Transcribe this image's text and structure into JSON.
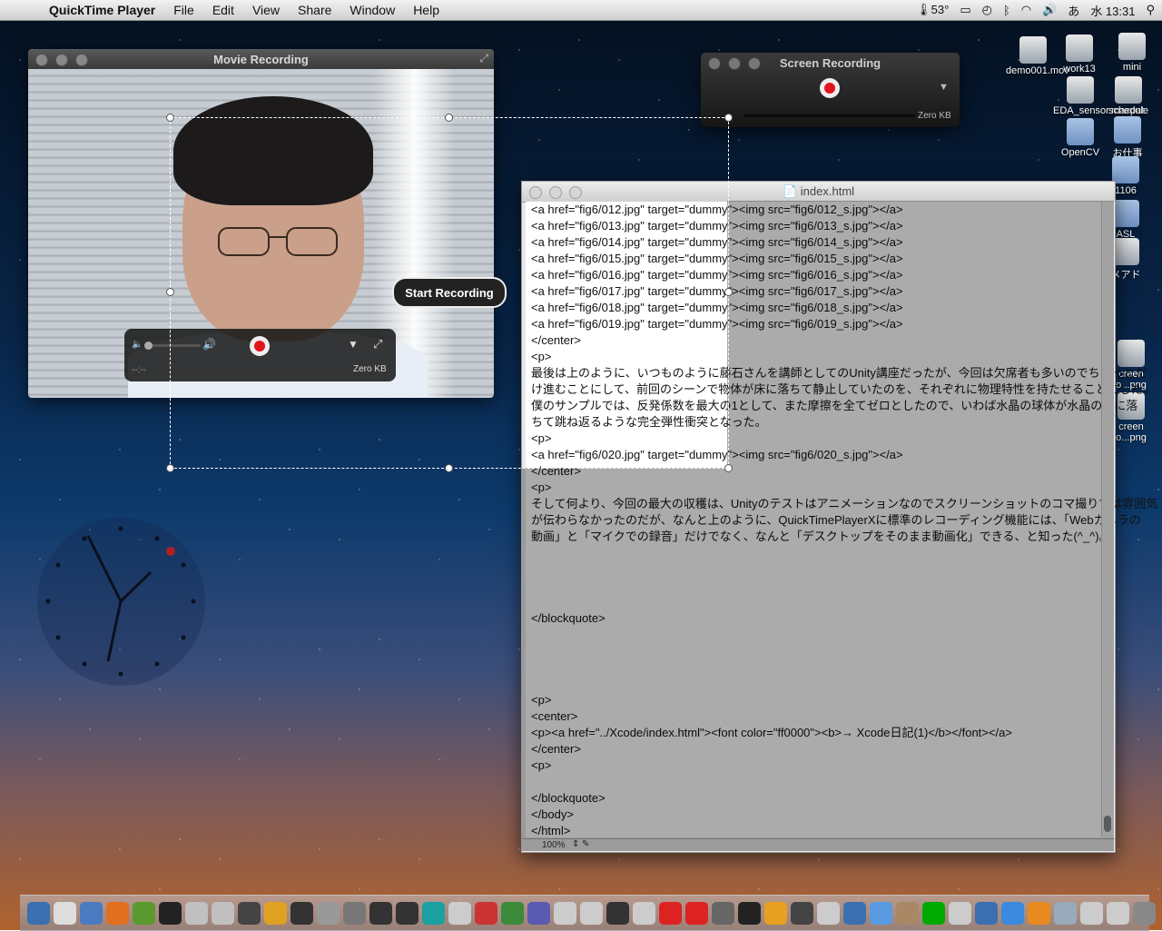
{
  "menubar": {
    "app_name": "QuickTime Player",
    "menus": [
      "File",
      "Edit",
      "View",
      "Share",
      "Window",
      "Help"
    ],
    "temperature": "53°",
    "time": "水 13:31"
  },
  "movie_recording": {
    "title": "Movie Recording",
    "time_display": "--:--",
    "size_display": "Zero KB"
  },
  "screen_recording": {
    "title": "Screen Recording",
    "size_display": "Zero KB"
  },
  "selection": {
    "start_recording_label": "Start Recording"
  },
  "editor": {
    "title": "index.html",
    "zoom": "100%",
    "lines": [
      "<a href=\"fig6/012.jpg\" target=\"dummy\"><img src=\"fig6/012_s.jpg\"></a>",
      "<a href=\"fig6/013.jpg\" target=\"dummy\"><img src=\"fig6/013_s.jpg\"></a>",
      "<a href=\"fig6/014.jpg\" target=\"dummy\"><img src=\"fig6/014_s.jpg\"></a>",
      "<a href=\"fig6/015.jpg\" target=\"dummy\"><img src=\"fig6/015_s.jpg\"></a>",
      "<a href=\"fig6/016.jpg\" target=\"dummy\"><img src=\"fig6/016_s.jpg\"></a>",
      "<a href=\"fig6/017.jpg\" target=\"dummy\"><img src=\"fig6/017_s.jpg\"></a>",
      "<a href=\"fig6/018.jpg\" target=\"dummy\"><img src=\"fig6/018_s.jpg\"></a>",
      "<a href=\"fig6/019.jpg\" target=\"dummy\"><img src=\"fig6/019_s.jpg\"></a>",
      "</center>",
      "<p>",
      "最後は上のように、いつものように藤石さんを講師としてのUnity講座だったが、今回は欠席者も多いのでちょっとだ",
      "け進むことにして、前回のシーンで物体が床に落ちて静止していたのを、それぞれに物理特性を持たせることにした。",
      "僕のサンプルでは、反発係数を最大の1として、また摩擦を全てゼロとしたので、いわば水晶の球体が水晶の床に落",
      "ちて跳ね返るような完全弾性衝突となった。",
      "<p>",
      "<a href=\"fig6/020.jpg\" target=\"dummy\"><img src=\"fig6/020_s.jpg\"></a>",
      "</center>",
      "<p>",
      "そして何より、今回の最大の収穫は、Unityのテストはアニメーションなのでスクリーンショットのコマ撮りでは雰囲気",
      "が伝わらなかったのだが、なんと上のように、QuickTimePlayerXに標準のレコーディング機能には、「Webカメラの",
      "動画」と「マイクでの録音」だけでなく、なんと「デスクトップをそのまま動画化」できる、と知った(^_^)。",
      "",
      "",
      "",
      "",
      "</blockquote>",
      "",
      "",
      "",
      "",
      "<p>",
      "<center>",
      "<p><a href=\"../Xcode/index.html\"><font color=\"ff0000\"><b>→ Xcode日記(1)</b></font></a>",
      "</center>",
      "<p>",
      "",
      "</blockquote>",
      "</body>",
      "</html>"
    ]
  },
  "desktop_icons": [
    {
      "label": "demo001.mov"
    },
    {
      "label": "work13"
    },
    {
      "label": "mini"
    },
    {
      "label": "EDA_sensor.maxpat"
    },
    {
      "label": "schedule"
    },
    {
      "label": "OpenCV"
    },
    {
      "label": "お仕事"
    },
    {
      "label": "1106"
    },
    {
      "label": "ASL"
    },
    {
      "label": "メアド"
    },
    {
      "label": "creen o...png"
    },
    {
      "label": "creen o...png"
    }
  ],
  "colors": {
    "record_red": "#e4141b",
    "selection_border": "#ffffff"
  }
}
